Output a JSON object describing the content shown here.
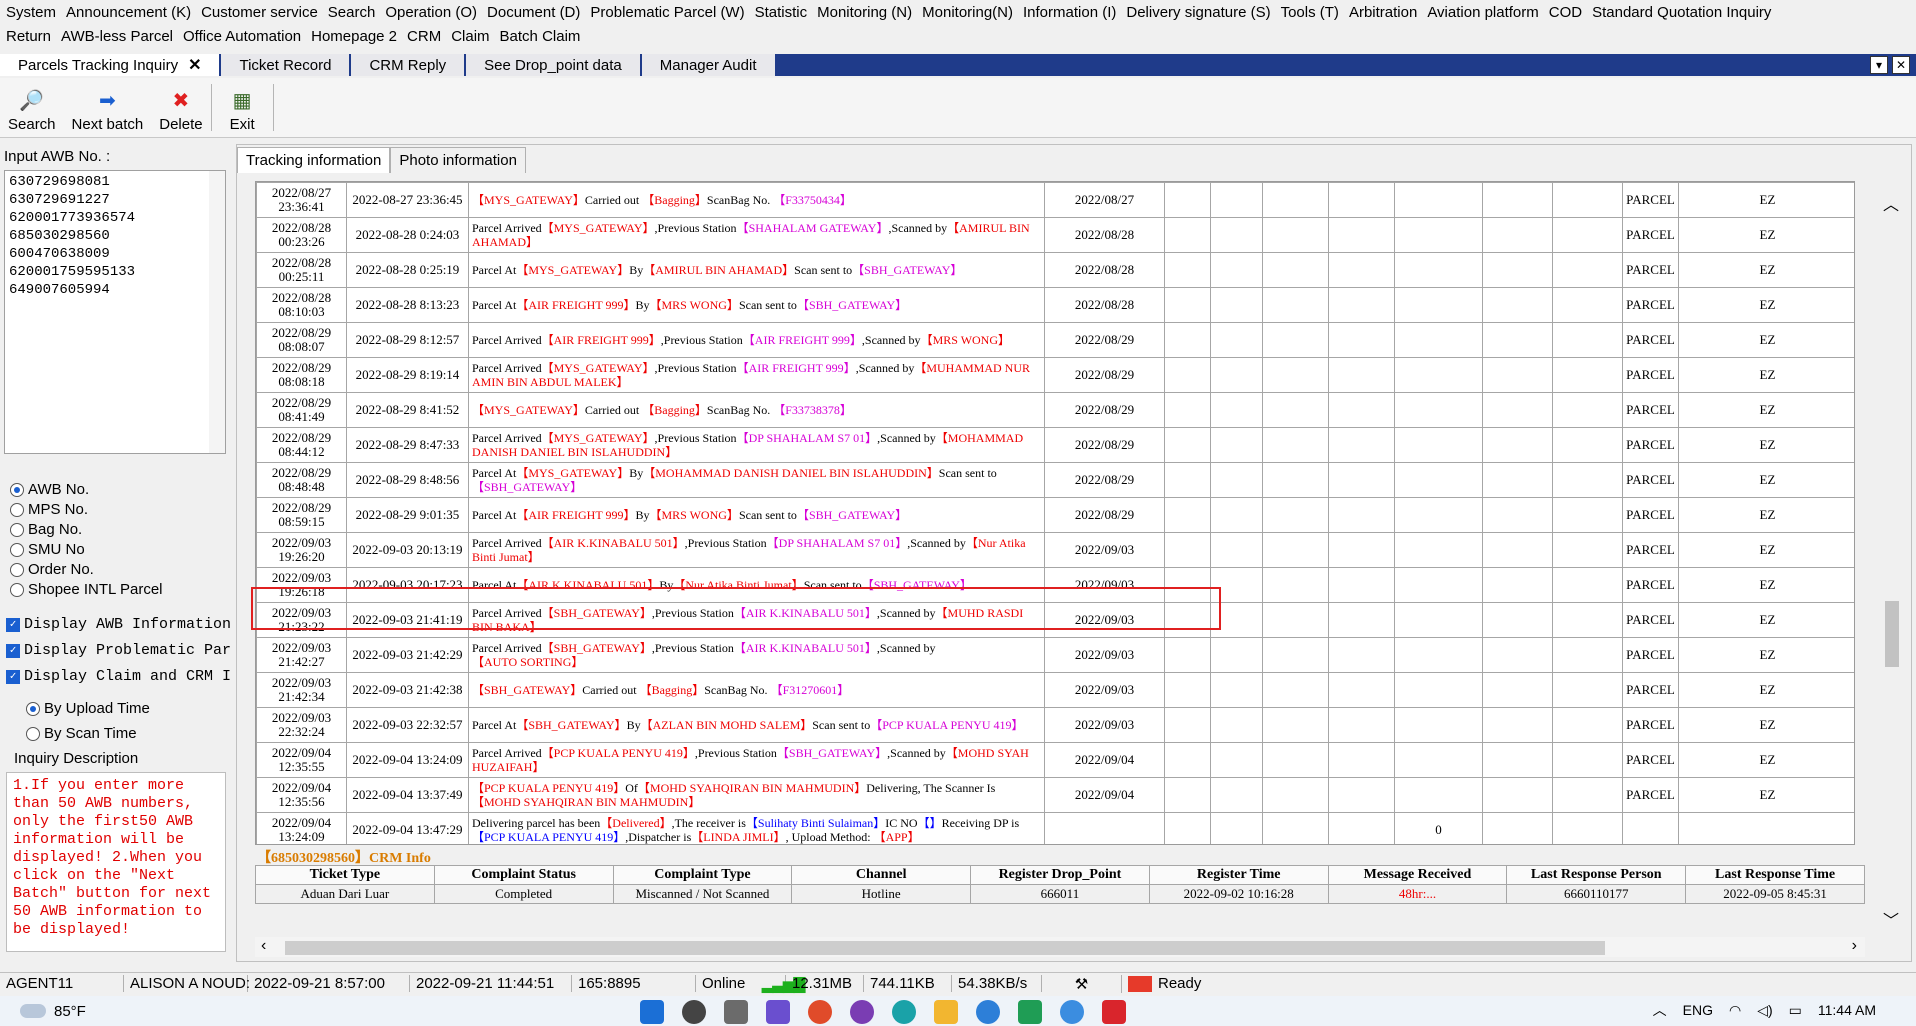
{
  "menu": {
    "row1": [
      "System",
      "Announcement (K)",
      "Customer service",
      "Search",
      "Operation (O)",
      "Document (D)",
      "Problematic Parcel (W)",
      "Statistic",
      "Monitoring (N)",
      "Monitoring(N)",
      "Information (I)",
      "Delivery signature (S)",
      "Tools (T)",
      "Arbitration",
      "Aviation platform",
      "COD",
      "Standard Quotation Inquiry"
    ],
    "row2": [
      "Return",
      "AWB-less Parcel",
      "Office Automation",
      "Homepage 2",
      "CRM",
      "Claim",
      "Batch Claim"
    ]
  },
  "tabs": [
    {
      "label": "Parcels Tracking Inquiry",
      "close": "✕"
    },
    {
      "label": "Ticket Record"
    },
    {
      "label": "CRM Reply"
    },
    {
      "label": "See Drop_point data"
    },
    {
      "label": "Manager Audit"
    }
  ],
  "tab_controls": [
    "▾",
    "✕"
  ],
  "toolbar": {
    "search": {
      "label": "Search",
      "icon": "🔎"
    },
    "next_batch": {
      "label": "Next batch",
      "icon": "➡"
    },
    "delete": {
      "label": "Delete",
      "icon": "✖"
    },
    "exit": {
      "label": "Exit",
      "icon": "▦"
    }
  },
  "left": {
    "input_label": "Input AWB No. :",
    "awb_numbers": [
      "630729698081",
      "630729691227",
      "620001773936574",
      "685030298560",
      "600470638009",
      "620001759595133",
      "649007605994"
    ],
    "search_types": [
      {
        "label": "AWB No.",
        "checked": true
      },
      {
        "label": "MPS No.",
        "checked": false
      },
      {
        "label": "Bag No.",
        "checked": false
      },
      {
        "label": "SMU No",
        "checked": false
      },
      {
        "label": "Order No.",
        "checked": false
      },
      {
        "label": "Shopee INTL Parcel",
        "checked": false
      }
    ],
    "checks": [
      "Display AWB Information",
      "Display Problematic Par",
      "Display Claim and CRM I"
    ],
    "time_options": [
      {
        "label": "By Upload Time",
        "checked": true
      },
      {
        "label": "By Scan Time",
        "checked": false
      }
    ],
    "inquiry_title": "Inquiry Description",
    "inquiry_text": "1.If you enter more than  50  AWB numbers, only the first50  AWB information will be displayed! 2.When you click on the \"Next Batch\" button for next  50  AWB information to be displayed!"
  },
  "subtabs": [
    "Tracking information",
    "Photo information"
  ],
  "tracking_rows": [
    {
      "t1": "2022/08/27",
      "t2": "23:36:41",
      "scan": "2022-08-27 23:36:45",
      "desc": [
        [
          "red",
          "【MYS_GATEWAY】"
        ],
        [
          "",
          "Carried out "
        ],
        [
          "red",
          "【Bagging】"
        ],
        [
          "",
          "ScanBag No. "
        ],
        [
          "mag",
          "【F33750434】"
        ]
      ],
      "date": "2022/08/27",
      "type": "PARCEL",
      "code": "EZ",
      "extra": ""
    },
    {
      "t1": "2022/08/28",
      "t2": "00:23:26",
      "scan": "2022-08-28 0:24:03",
      "desc": [
        [
          "",
          "Parcel Arrived"
        ],
        [
          "red",
          "【MYS_GATEWAY】"
        ],
        [
          "",
          ",Previous Station"
        ],
        [
          "mag",
          "【SHAHALAM GATEWAY】"
        ],
        [
          "",
          ",Scanned by"
        ],
        [
          "red",
          "【AMIRUL BIN AHAMAD】"
        ]
      ],
      "date": "2022/08/28",
      "type": "PARCEL",
      "code": "EZ",
      "extra": ""
    },
    {
      "t1": "2022/08/28",
      "t2": "00:25:11",
      "scan": "2022-08-28 0:25:19",
      "desc": [
        [
          "",
          "Parcel At"
        ],
        [
          "red",
          "【MYS_GATEWAY】"
        ],
        [
          "",
          "By"
        ],
        [
          "red",
          "【AMIRUL BIN AHAMAD】"
        ],
        [
          "",
          "Scan sent to"
        ],
        [
          "mag",
          "【SBH_GATEWAY】"
        ]
      ],
      "date": "2022/08/28",
      "type": "PARCEL",
      "code": "EZ",
      "extra": ""
    },
    {
      "t1": "2022/08/28",
      "t2": "08:10:03",
      "scan": "2022-08-28 8:13:23",
      "desc": [
        [
          "",
          "Parcel At"
        ],
        [
          "red",
          "【AIR FREIGHT 999】"
        ],
        [
          "",
          "By"
        ],
        [
          "red",
          "【MRS WONG】"
        ],
        [
          "",
          "Scan sent to"
        ],
        [
          "mag",
          "【SBH_GATEWAY】"
        ]
      ],
      "date": "2022/08/28",
      "type": "PARCEL",
      "code": "EZ",
      "extra": ""
    },
    {
      "t1": "2022/08/29",
      "t2": "08:08:07",
      "scan": "2022-08-29 8:12:57",
      "desc": [
        [
          "",
          "Parcel Arrived"
        ],
        [
          "red",
          "【AIR FREIGHT 999】"
        ],
        [
          "",
          ",Previous Station"
        ],
        [
          "mag",
          "【AIR FREIGHT 999】"
        ],
        [
          "",
          ",Scanned by"
        ],
        [
          "red",
          "【MRS WONG】"
        ]
      ],
      "date": "2022/08/29",
      "type": "PARCEL",
      "code": "EZ",
      "extra": ""
    },
    {
      "t1": "2022/08/29",
      "t2": "08:08:18",
      "scan": "2022-08-29 8:19:14",
      "desc": [
        [
          "",
          "Parcel Arrived"
        ],
        [
          "red",
          "【MYS_GATEWAY】"
        ],
        [
          "",
          ",Previous Station"
        ],
        [
          "mag",
          "【AIR FREIGHT 999】"
        ],
        [
          "",
          ",Scanned by"
        ],
        [
          "red",
          "【MUHAMMAD NUR AMIN BIN ABDUL MALEK】"
        ]
      ],
      "date": "2022/08/29",
      "type": "PARCEL",
      "code": "EZ",
      "extra": ""
    },
    {
      "t1": "2022/08/29",
      "t2": "08:41:49",
      "scan": "2022-08-29 8:41:52",
      "desc": [
        [
          "red",
          "【MYS_GATEWAY】"
        ],
        [
          "",
          "Carried out "
        ],
        [
          "red",
          "【Bagging】"
        ],
        [
          "",
          "ScanBag No. "
        ],
        [
          "mag",
          "【F33738378】"
        ]
      ],
      "date": "2022/08/29",
      "type": "PARCEL",
      "code": "EZ",
      "extra": ""
    },
    {
      "t1": "2022/08/29",
      "t2": "08:44:12",
      "scan": "2022-08-29 8:47:33",
      "desc": [
        [
          "",
          "Parcel Arrived"
        ],
        [
          "red",
          "【MYS_GATEWAY】"
        ],
        [
          "",
          ",Previous Station"
        ],
        [
          "mag",
          "【DP SHAHALAM S7 01】"
        ],
        [
          "",
          ",Scanned by"
        ],
        [
          "red",
          "【MOHAMMAD DANISH DANIEL BIN ISLAHUDDIN】"
        ]
      ],
      "date": "2022/08/29",
      "type": "PARCEL",
      "code": "EZ",
      "extra": ""
    },
    {
      "t1": "2022/08/29",
      "t2": "08:48:48",
      "scan": "2022-08-29 8:48:56",
      "desc": [
        [
          "",
          "Parcel At"
        ],
        [
          "red",
          "【MYS_GATEWAY】"
        ],
        [
          "",
          "By"
        ],
        [
          "red",
          "【MOHAMMAD DANISH DANIEL BIN ISLAHUDDIN】"
        ],
        [
          "",
          "Scan sent to"
        ],
        [
          "mag",
          "【SBH_GATEWAY】"
        ]
      ],
      "date": "2022/08/29",
      "type": "PARCEL",
      "code": "EZ",
      "extra": ""
    },
    {
      "t1": "2022/08/29",
      "t2": "08:59:15",
      "scan": "2022-08-29 9:01:35",
      "desc": [
        [
          "",
          "Parcel At"
        ],
        [
          "red",
          "【AIR FREIGHT 999】"
        ],
        [
          "",
          "By"
        ],
        [
          "red",
          "【MRS WONG】"
        ],
        [
          "",
          "Scan sent to"
        ],
        [
          "mag",
          "【SBH_GATEWAY】"
        ]
      ],
      "date": "2022/08/29",
      "type": "PARCEL",
      "code": "EZ",
      "extra": ""
    },
    {
      "t1": "2022/09/03",
      "t2": "19:26:20",
      "scan": "2022-09-03 20:13:19",
      "desc": [
        [
          "",
          "Parcel Arrived"
        ],
        [
          "red",
          "【AIR K.KINABALU 501】"
        ],
        [
          "",
          ",Previous Station"
        ],
        [
          "mag",
          "【DP SHAHALAM S7 01】"
        ],
        [
          "",
          ",Scanned by"
        ],
        [
          "red",
          "【Nur Atika Binti Jumat】"
        ]
      ],
      "date": "2022/09/03",
      "type": "PARCEL",
      "code": "EZ",
      "extra": ""
    },
    {
      "t1": "2022/09/03",
      "t2": "19:26:18",
      "scan": "2022-09-03 20:17:23",
      "desc": [
        [
          "",
          "Parcel At"
        ],
        [
          "red",
          "【AIR K.KINABALU 501】"
        ],
        [
          "",
          "By"
        ],
        [
          "red",
          "【Nur Atika Binti Jumat】"
        ],
        [
          "",
          "Scan sent to"
        ],
        [
          "mag",
          "【SBH_GATEWAY】"
        ]
      ],
      "date": "2022/09/03",
      "type": "PARCEL",
      "code": "EZ",
      "extra": ""
    },
    {
      "t1": "2022/09/03",
      "t2": "21:23:22",
      "scan": "2022-09-03 21:41:19",
      "desc": [
        [
          "",
          "Parcel Arrived"
        ],
        [
          "red",
          "【SBH_GATEWAY】"
        ],
        [
          "",
          ",Previous Station"
        ],
        [
          "mag",
          "【AIR K.KINABALU 501】"
        ],
        [
          "",
          ",Scanned by"
        ],
        [
          "red",
          "【MUHD RASDI BIN BAKA】"
        ]
      ],
      "date": "2022/09/03",
      "type": "PARCEL",
      "code": "EZ",
      "extra": ""
    },
    {
      "t1": "2022/09/03",
      "t2": "21:42:27",
      "scan": "2022-09-03 21:42:29",
      "desc": [
        [
          "",
          "Parcel Arrived"
        ],
        [
          "red",
          "【SBH_GATEWAY】"
        ],
        [
          "",
          ",Previous Station"
        ],
        [
          "mag",
          "【AIR K.KINABALU 501】"
        ],
        [
          "",
          ",Scanned by"
        ],
        [
          "red",
          "【AUTO SORTING】"
        ]
      ],
      "date": "2022/09/03",
      "type": "PARCEL",
      "code": "EZ",
      "extra": ""
    },
    {
      "t1": "2022/09/03",
      "t2": "21:42:34",
      "scan": "2022-09-03 21:42:38",
      "desc": [
        [
          "red",
          "【SBH_GATEWAY】"
        ],
        [
          "",
          "Carried out "
        ],
        [
          "red",
          "【Bagging】"
        ],
        [
          "",
          "ScanBag No. "
        ],
        [
          "mag",
          "【F31270601】"
        ]
      ],
      "date": "2022/09/03",
      "type": "PARCEL",
      "code": "EZ",
      "extra": ""
    },
    {
      "t1": "2022/09/03",
      "t2": "22:32:24",
      "scan": "2022-09-03 22:32:57",
      "desc": [
        [
          "",
          "Parcel At"
        ],
        [
          "red",
          "【SBH_GATEWAY】"
        ],
        [
          "",
          "By"
        ],
        [
          "red",
          "【AZLAN BIN MOHD SALEM】"
        ],
        [
          "",
          "Scan sent to"
        ],
        [
          "mag",
          "【PCP KUALA PENYU 419】"
        ]
      ],
      "date": "2022/09/03",
      "type": "PARCEL",
      "code": "EZ",
      "extra": ""
    },
    {
      "t1": "2022/09/04",
      "t2": "12:35:55",
      "scan": "2022-09-04 13:24:09",
      "desc": [
        [
          "",
          "Parcel Arrived"
        ],
        [
          "red",
          "【PCP KUALA PENYU 419】"
        ],
        [
          "",
          ",Previous Station"
        ],
        [
          "mag",
          "【SBH_GATEWAY】"
        ],
        [
          "",
          ",Scanned by"
        ],
        [
          "red",
          "【MOHD SYAH HUZAIFAH】"
        ]
      ],
      "date": "2022/09/04",
      "type": "PARCEL",
      "code": "EZ",
      "extra": ""
    },
    {
      "t1": "2022/09/04",
      "t2": "12:35:56",
      "scan": "2022-09-04 13:37:49",
      "desc": [
        [
          "red",
          "【PCP KUALA PENYU 419】"
        ],
        [
          "",
          "Of"
        ],
        [
          "red",
          "【MOHD SYAHQIRAN BIN MAHMUDIN】"
        ],
        [
          "",
          "Delivering, The Scanner Is"
        ],
        [
          "red",
          "【MOHD SYAHQIRAN BIN MAHMUDIN】"
        ]
      ],
      "date": "2022/09/04",
      "type": "PARCEL",
      "code": "EZ",
      "extra": ""
    },
    {
      "t1": "2022/09/04",
      "t2": "13:24:09",
      "scan": "2022-09-04 13:47:29",
      "desc": [
        [
          "",
          "Delivering parcel has been"
        ],
        [
          "red",
          "【Delivered】"
        ],
        [
          "",
          ",The receiver is"
        ],
        [
          "blu",
          "【Sulihaty Binti Sulaiman】"
        ],
        [
          "",
          "IC NO"
        ],
        [
          "blu",
          "【】"
        ],
        [
          "",
          "Receiving DP is"
        ],
        [
          "blu",
          "【PCP KUALA PENYU 419】"
        ],
        [
          "",
          ",Dispatcher is"
        ],
        [
          "red",
          "【LINDA JIMLI】"
        ],
        [
          "",
          ", Upload Method: "
        ],
        [
          "red",
          "【APP】"
        ]
      ],
      "date": "",
      "type": "",
      "code": "",
      "extra": "0"
    }
  ],
  "crm": {
    "title": "【685030298560】CRM Info",
    "headers": [
      "Ticket Type",
      "Complaint Status",
      "Complaint Type",
      "Channel",
      "Register Drop_Point",
      "Register Time",
      "Message Received",
      "Last Response Person",
      "Last Response Time"
    ],
    "row": [
      "Aduan Dari Luar",
      "Completed",
      "Miscanned / Not Scanned",
      "Hotline",
      "666011",
      "2022-09-02 10:16:28",
      "48hr:...",
      "6660110177",
      "2022-09-05 8:45:31"
    ]
  },
  "status": {
    "user": "AGENT11",
    "name": "ALISON A NOUD:",
    "login_time": "2022-09-21 8:57:00",
    "now": "2022-09-21 11:44:51",
    "port": "165:8895",
    "online": "Online",
    "bars": "▂▃▅▇",
    "mem": "12.31MB",
    "traffic": "744.11KB",
    "speed": "54.38KB/s",
    "ready": "Ready"
  },
  "taskbar": {
    "temp": "85°F",
    "lang": "ENG",
    "time": "11:44 AM"
  },
  "colors": {
    "tab_strip": "#1f3b8a",
    "highlight": "#e02020",
    "red_text": "#ee0000",
    "magenta_text": "#d600d6"
  }
}
